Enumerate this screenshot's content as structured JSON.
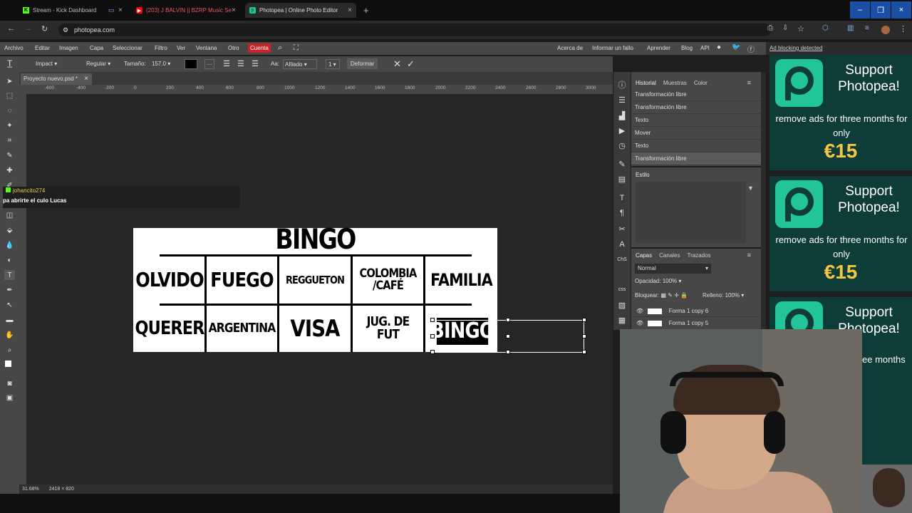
{
  "browser": {
    "tabs": [
      {
        "label": "Stream - Kick Dashboard",
        "icon": "kick-icon"
      },
      {
        "label": "(203) J BALVIN || BZRP Music Se",
        "icon": "youtube-icon"
      },
      {
        "label": "Photopea | Online Photo Editor",
        "icon": "photopea-icon"
      }
    ],
    "url": "photopea.com"
  },
  "menu": {
    "items": [
      "Archivo",
      "Editar",
      "Imagen",
      "Capa",
      "Seleccionar",
      "Filtro",
      "Ver",
      "Ventana",
      "Otro",
      "Cuenta"
    ],
    "right_items": [
      "Acerca de",
      "Informar un fallo",
      "Aprender",
      "Blog",
      "API"
    ]
  },
  "options": {
    "font": "Impact",
    "weight": "Regular",
    "size_label": "Tamaño:",
    "size": "157.0",
    "aa_label": "Aa:",
    "aa": "Afilado",
    "deform": "Deformar",
    "dots": "...",
    "one": "1"
  },
  "doc": {
    "tab": "Proyecto nuevo.psd *"
  },
  "ruler": {
    "ticks": [
      "-600",
      "-400",
      "-200",
      "0",
      "200",
      "400",
      "600",
      "800",
      "1000",
      "1200",
      "1400",
      "1600",
      "1800",
      "2000",
      "2200",
      "2400",
      "2600",
      "2800",
      "3000"
    ]
  },
  "status": {
    "zoom": "31.68%",
    "dims": "2418 × 820"
  },
  "chat": {
    "user": "johancito274",
    "message": "pa abrirte el culo Lucas"
  },
  "canvas": {
    "title": "BINGO",
    "row1": [
      "OLVIDO",
      "FUEGO",
      "REGGUETON",
      "COLOMBIA /CAFÉ",
      "FAMILIA"
    ],
    "row2": [
      "QUERER",
      "ARGENTINA",
      "VISA",
      "JUG. DE FUT",
      "BINGO"
    ]
  },
  "history": {
    "tabs": [
      "Historial",
      "Muestras",
      "Color"
    ],
    "items": [
      "Transformación libre",
      "Transformación libre",
      "Texto",
      "Mover",
      "Texto",
      "Transformación libre"
    ],
    "style_label": "Estilo"
  },
  "layers": {
    "tabs": [
      "Capas",
      "Canales",
      "Trazados"
    ],
    "blend": "Normal",
    "opacity_label": "Opacidad:",
    "opacity": "100%",
    "lock_label": "Bloquear:",
    "fill_label": "Relleno:",
    "fill": "100%",
    "items": [
      "Forma 1 copy 6",
      "Forma 1 copy 5"
    ]
  },
  "ads": {
    "banner": "Ad blocking detected",
    "title": "Support Photopea!",
    "subtitle": "remove ads for three months for only",
    "price": "€15",
    "partial_title": "Support Photopea!",
    "partial_subtitle": "ee months"
  },
  "colors": {
    "accent_red": "#c8232c",
    "ad_bg": "#0e3c38",
    "ad_green": "#22c49a",
    "price": "#f3c743"
  }
}
